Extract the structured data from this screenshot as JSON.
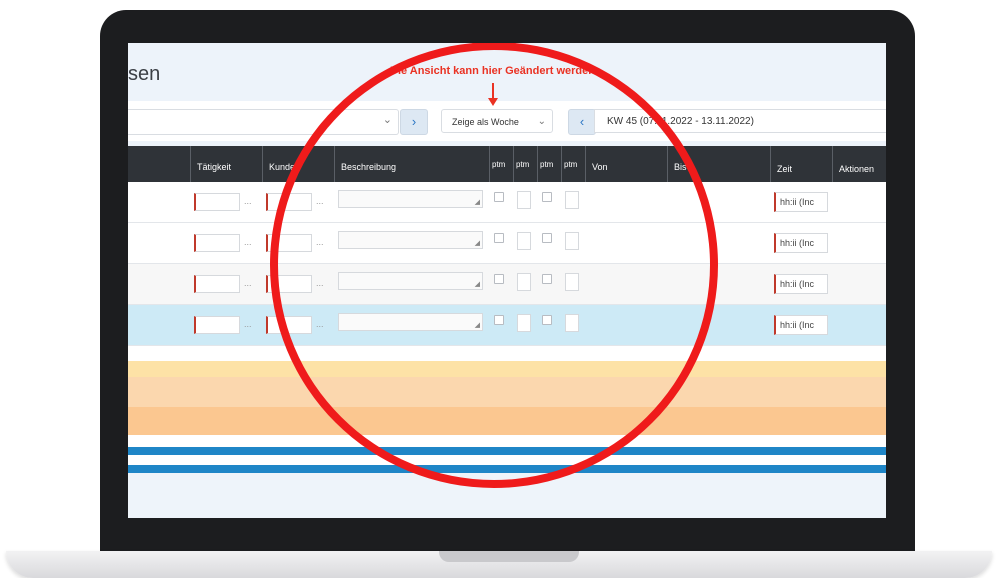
{
  "page": {
    "title_partial": "sen",
    "annotation": "Die Ansicht kann hier Geändert werden"
  },
  "toolbar": {
    "select_chevron": "⌄",
    "next_button": "›",
    "view_select": "Zeige als Woche",
    "view_chevron": "⌄",
    "prev_button": "‹",
    "week_label": "KW 45 (07.11.2022 - 13.11.2022)"
  },
  "table": {
    "columns": [
      "Tätigkeit",
      "Kunde",
      "Beschreibung",
      "ptm",
      "ptm",
      "ptm",
      "ptm",
      "Von",
      "Bis",
      "Zeit",
      "Aktionen"
    ],
    "row_count": 4,
    "time_placeholder": "hh:ii (Inc",
    "dots": "..."
  },
  "colors": {
    "header_bg": "#2f3338",
    "selected_row": "#cdeaf6",
    "band_yellow": "#fde2a6",
    "band_orange": "#fbc790",
    "band_blue": "#1f86c7",
    "highlight_circle": "#ef1b1b",
    "annotation_text": "#ea3223"
  }
}
